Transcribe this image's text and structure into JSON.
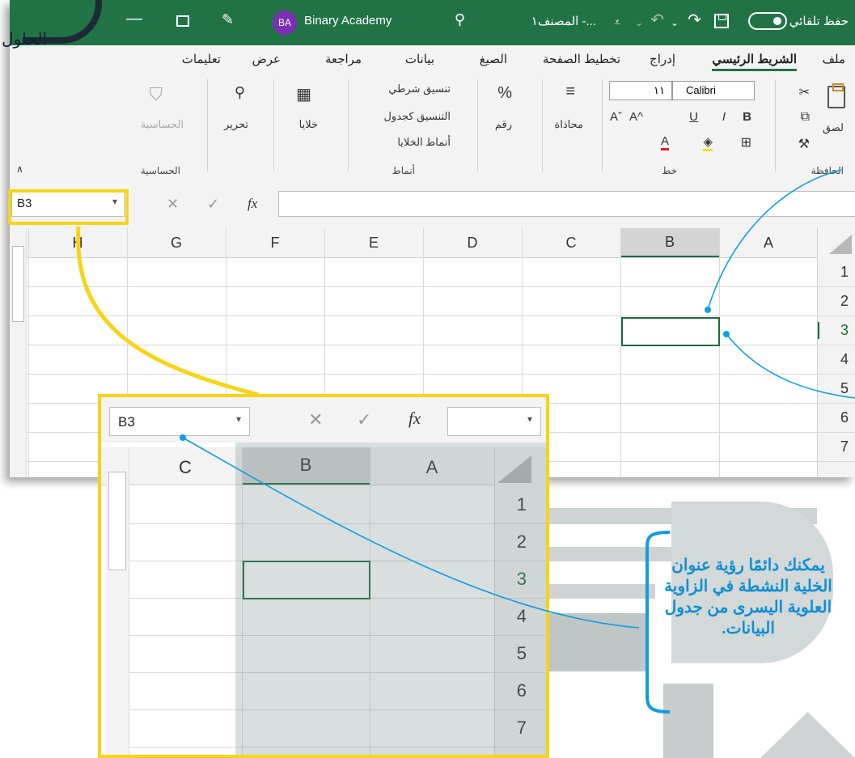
{
  "window": {
    "autosave_label": "حفظ تلقائي",
    "document_name": "المصنف١ -...",
    "user_initials": "BA",
    "user_name": "Binary Academy"
  },
  "menu_tabs": [
    "ملف",
    "الشريط الرئيسي",
    "إدراج",
    "تخطيط الصفحة",
    "الصيغ",
    "بيانات",
    "مراجعة",
    "عرض",
    "تعليمات"
  ],
  "ribbon": {
    "paste_label": "لصق",
    "clipboard_group": "الحافظة",
    "font_name": "Calibri",
    "font_size": "١١",
    "font_group": "خط",
    "alignment_label": "محاذاة",
    "number_label": "رقم",
    "number_symbol": "%",
    "conditional_formatting": "تنسيق شرطي",
    "format_as_table": "التنسيق كجدول",
    "cell_styles": "أنماط الخلايا",
    "styles_group": "أنماط",
    "cells_label": "خلايا",
    "editing_label": "تحرير",
    "sensitivity_label": "الحساسية",
    "sensitivity_group": "الحساسية"
  },
  "formula_bar": {
    "name_box": "B3",
    "fx_label": "fx"
  },
  "grid": {
    "columns": [
      "A",
      "B",
      "C",
      "D",
      "E",
      "F",
      "G",
      "H"
    ],
    "rows": [
      "1",
      "2",
      "3",
      "4",
      "5",
      "6",
      "7"
    ],
    "active_cell": "B3"
  },
  "zoom": {
    "name_box": "B3",
    "columns": [
      "A",
      "B",
      "C"
    ],
    "rows": [
      "1",
      "2",
      "3",
      "4",
      "5",
      "6",
      "7"
    ]
  },
  "callout": {
    "text": "يمكنك دائمًا رؤية عنوان الخلية النشطة في الزاوية العلوية اليسرى من جدول البيانات."
  },
  "logo": {
    "text": "الحلول",
    "colors": {
      "accent": "#0e8fd3",
      "highlight": "#f7d417",
      "excel_green": "#217346"
    }
  }
}
